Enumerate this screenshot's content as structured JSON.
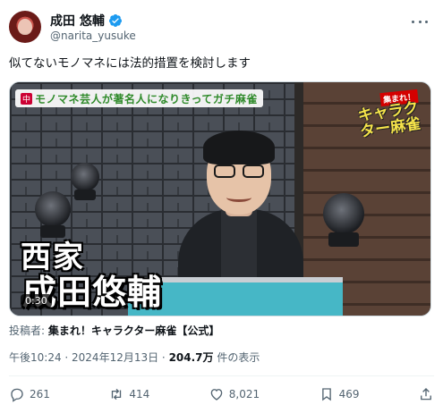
{
  "author": {
    "display_name": "成田 悠輔",
    "handle": "@narita_yusuke",
    "verified": true
  },
  "tweet": {
    "text": "似てないモノマネには法的措置を検討します"
  },
  "media": {
    "banner": "モノマネ芸人が著名人になりきってガチ麻雀",
    "banner_badge": "中",
    "logo_top": "集まれ！",
    "logo_main": "キャラクター麻雀",
    "seat_caption": "西家",
    "name_caption": "成田悠輔",
    "duration": "0:30"
  },
  "attribution": {
    "label": "投稿者:",
    "source": "集まれ！キャラクター麻雀【公式】"
  },
  "meta": {
    "datetime": "午後10:24 · 2024年12月13日 · ",
    "views_count": "204.7万",
    "views_suffix": " 件の表示"
  },
  "actions": {
    "replies": "261",
    "reposts": "414",
    "likes": "8,021",
    "bookmarks": "469"
  },
  "colors": {
    "verified_blue": "#1d9bf0",
    "secondary_text": "#536471"
  }
}
